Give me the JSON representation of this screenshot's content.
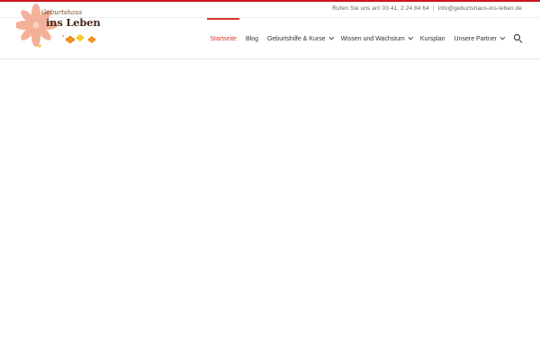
{
  "topbar": {
    "phone_text": "Rufen Sie uns an! 03 41. 2 24 84 64",
    "separator": "|",
    "email": "info@geburtshaus-ins-leben.de"
  },
  "logo": {
    "line1": "Geburtshaus",
    "line2": "ins Leben"
  },
  "nav": {
    "items": [
      {
        "label": "Startseite",
        "active": true
      },
      {
        "label": "Blog"
      },
      {
        "label": "Geburtshilfe & Kurse",
        "dropdown": true
      },
      {
        "label": "Wissen und Wachstum",
        "dropdown": true
      },
      {
        "label": "Kursplan"
      },
      {
        "label": "Unsere Partner",
        "dropdown": true
      }
    ]
  },
  "colors": {
    "accent": "#d9362f",
    "top_bar": "#c8181e",
    "logo_petal": "#f4b199",
    "logo_flower_orange": "#f08a1e",
    "logo_flower_yellow": "#f5c518"
  },
  "icons": {
    "search": "search-icon",
    "dropdown": "chevron-down-icon"
  }
}
